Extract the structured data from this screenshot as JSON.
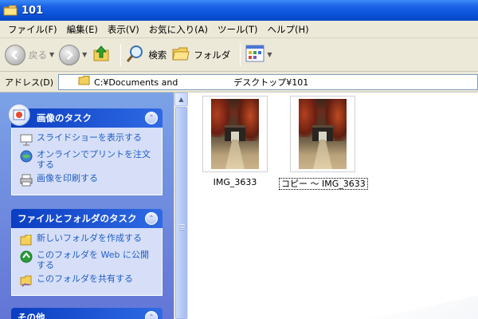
{
  "window": {
    "title": "101"
  },
  "menu": [
    "ファイル(F)",
    "編集(E)",
    "表示(V)",
    "お気に入り(A)",
    "ツール(T)",
    "ヘルプ(H)"
  ],
  "toolbar": {
    "back": "戻る",
    "search": "検索",
    "folders": "フォルダ"
  },
  "address": {
    "label": "アドレス(D)",
    "value": "C:¥Documents and                    デスクトップ¥101"
  },
  "tasks": {
    "picture": {
      "title": "画像のタスク",
      "items": [
        "スライドショーを表示する",
        "オンラインでプリントを注文する",
        "画像を印刷する"
      ]
    },
    "file_folder": {
      "title": "ファイルとフォルダのタスク",
      "items": [
        "新しいフォルダを作成する",
        "このフォルダを Web に公開する",
        "このフォルダを共有する"
      ]
    },
    "other": {
      "title": "その他"
    }
  },
  "files": [
    {
      "name": "IMG_3633"
    },
    {
      "name": "コピー 〜 IMG_3633"
    }
  ],
  "colors": {
    "titlebar": "#0a52d9",
    "task_link": "#215dc6",
    "pane": "#6f8de0"
  }
}
